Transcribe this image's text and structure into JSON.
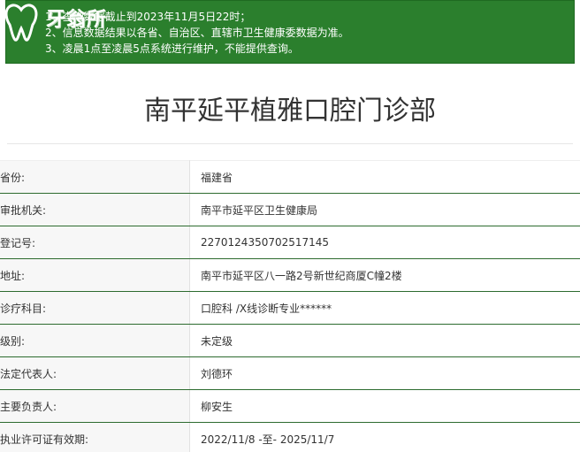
{
  "notice": {
    "lines": [
      "1、查询数据截止到2023年11月5日22时；",
      "2、信息数据结果以各省、自治区、直辖市卫生健康委数据为准。",
      "3、凌晨1点至凌晨5点系统进行维护，不能提供查询。"
    ]
  },
  "logo": {
    "text": "牙翁所"
  },
  "colors": {
    "notice_bg": "#2b7f2d",
    "row_divider": "#2d6b2f",
    "label_bg": "#f7f7f7"
  },
  "page": {
    "title": "南平延平植雅口腔门诊部"
  },
  "details": [
    {
      "label": "省份:",
      "value": "福建省"
    },
    {
      "label": "审批机关:",
      "value": "南平市延平区卫生健康局"
    },
    {
      "label": "登记号:",
      "value": "2270124350702517145"
    },
    {
      "label": "地址:",
      "value": "南平市延平区八一路2号新世纪商厦C幢2楼"
    },
    {
      "label": "诊疗科目:",
      "value": "口腔科 /X线诊断专业******"
    },
    {
      "label": "级别:",
      "value": "未定级"
    },
    {
      "label": "法定代表人:",
      "value": "刘德环"
    },
    {
      "label": "主要负责人:",
      "value": "柳安生"
    },
    {
      "label": "执业许可证有效期:",
      "value": "2022/11/8 -至- 2025/11/7"
    }
  ]
}
